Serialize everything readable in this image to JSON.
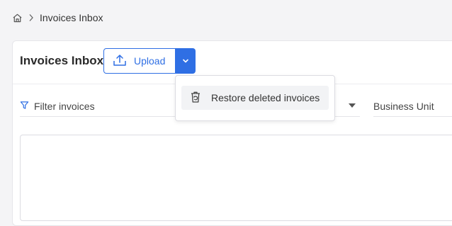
{
  "breadcrumb": {
    "home_icon": "home-icon",
    "separator_icon": "chevron-right-icon",
    "current": "Invoices Inbox"
  },
  "toolbar": {
    "title": "Invoices Inbox",
    "upload_label": "Upload",
    "upload_icon": "upload-icon",
    "split_icon": "chevron-down-icon"
  },
  "dropdown": {
    "items": [
      {
        "label": "Restore deleted invoices",
        "icon": "trash-restore-icon"
      }
    ]
  },
  "filters": {
    "filter_placeholder": "Filter invoices",
    "filter_icon": "filter-icon",
    "business_unit_label": "Business Unit"
  },
  "colors": {
    "accent": "#2f6fe4",
    "background": "#f4f4f6",
    "card": "#ffffff"
  }
}
